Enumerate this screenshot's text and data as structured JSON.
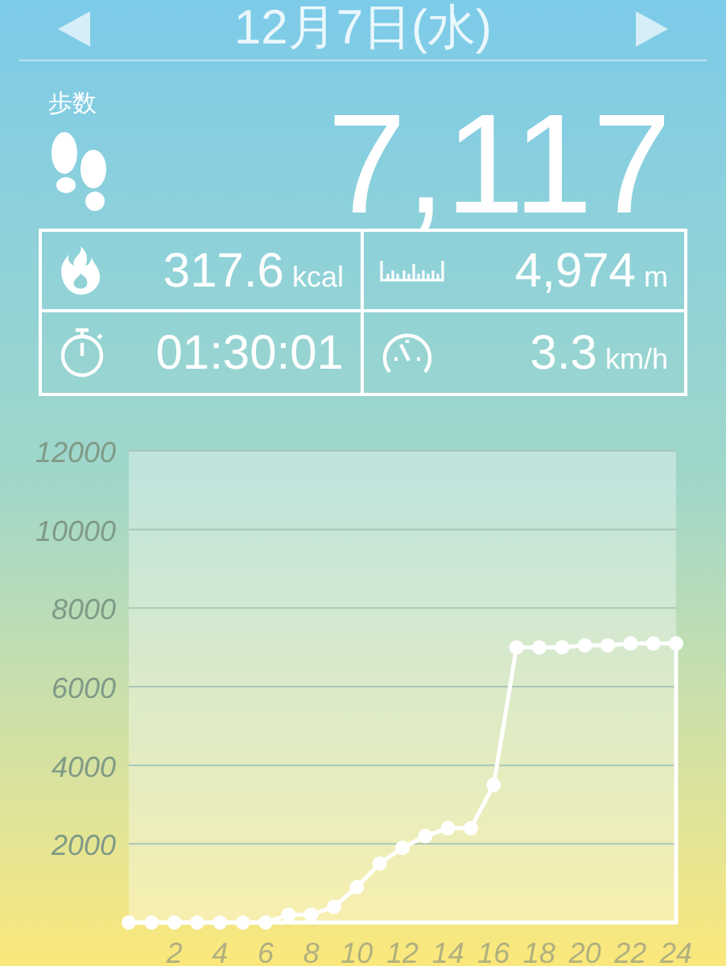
{
  "header": {
    "title": "12月7日(水)"
  },
  "steps": {
    "label": "歩数",
    "value": "7,117"
  },
  "stats": [
    {
      "kind": "calories",
      "value": "317.6",
      "unit": "kcal"
    },
    {
      "kind": "distance",
      "value": "4,974",
      "unit": "m"
    },
    {
      "kind": "duration",
      "value": "01:30:01"
    },
    {
      "kind": "speed",
      "value": "3.3",
      "unit": "km/h"
    }
  ],
  "chart": {
    "chart_data": {
      "type": "line",
      "x": [
        0,
        1,
        2,
        3,
        4,
        5,
        6,
        7,
        8,
        9,
        10,
        11,
        12,
        13,
        14,
        15,
        16,
        17,
        18,
        19,
        20,
        21,
        22,
        23,
        24
      ],
      "series": [
        {
          "color": "#ffffff",
          "marker": true,
          "values": [
            0,
            0,
            0,
            0,
            0,
            0,
            0,
            200,
            200,
            400,
            900,
            1500,
            1900,
            2200,
            2400,
            2400,
            3500,
            7000,
            7000,
            7000,
            7050,
            7050,
            7100,
            7100,
            7100
          ]
        }
      ],
      "grid": true,
      "xlim": [
        0,
        24
      ],
      "ylim": [
        0,
        12000
      ],
      "xticks": [
        2,
        4,
        6,
        8,
        10,
        12,
        14,
        16,
        18,
        20,
        22,
        24
      ],
      "yticks": [
        2000,
        4000,
        6000,
        8000,
        10000,
        12000
      ]
    }
  }
}
